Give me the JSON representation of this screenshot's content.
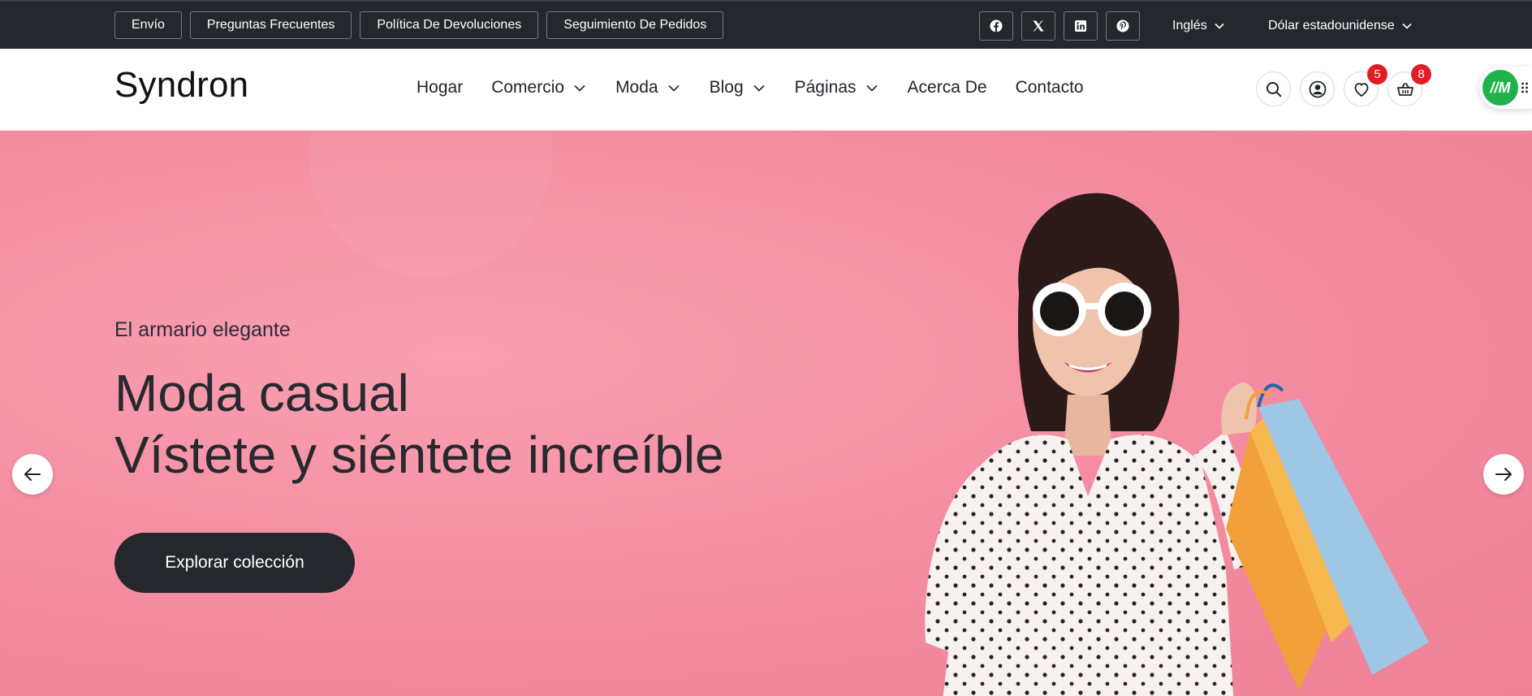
{
  "topbar": {
    "links": [
      "Envío",
      "Preguntas Frecuentes",
      "Política De Devoluciones",
      "Seguimiento De Pedidos"
    ],
    "socials": [
      "facebook-icon",
      "x-icon",
      "linkedin-icon",
      "pinterest-icon"
    ],
    "language": "Inglés",
    "currency": "Dólar estadounidense"
  },
  "header": {
    "logo": "Syndron",
    "nav": [
      "Hogar",
      "Comercio",
      "Moda",
      "Blog",
      "Páginas",
      "Acerca De",
      "Contacto"
    ],
    "nav_has_dropdown": [
      false,
      true,
      true,
      true,
      true,
      false,
      false
    ],
    "icons": [
      "search-icon",
      "user-icon",
      "heart-icon",
      "basket-icon"
    ],
    "wishlist_count": "5",
    "cart_count": "8",
    "widget_label": "//M"
  },
  "hero": {
    "eyebrow": "El armario elegante",
    "title_line1": "Moda casual",
    "title_line2": "Vístete y siéntete increíble",
    "cta": "Explorar colección"
  },
  "colors": {
    "topbar_bg": "#24272c",
    "hero_bg": "#f58ea3",
    "badge": "#e11d24",
    "widget": "#21b24b",
    "dark_text": "#26292e"
  }
}
